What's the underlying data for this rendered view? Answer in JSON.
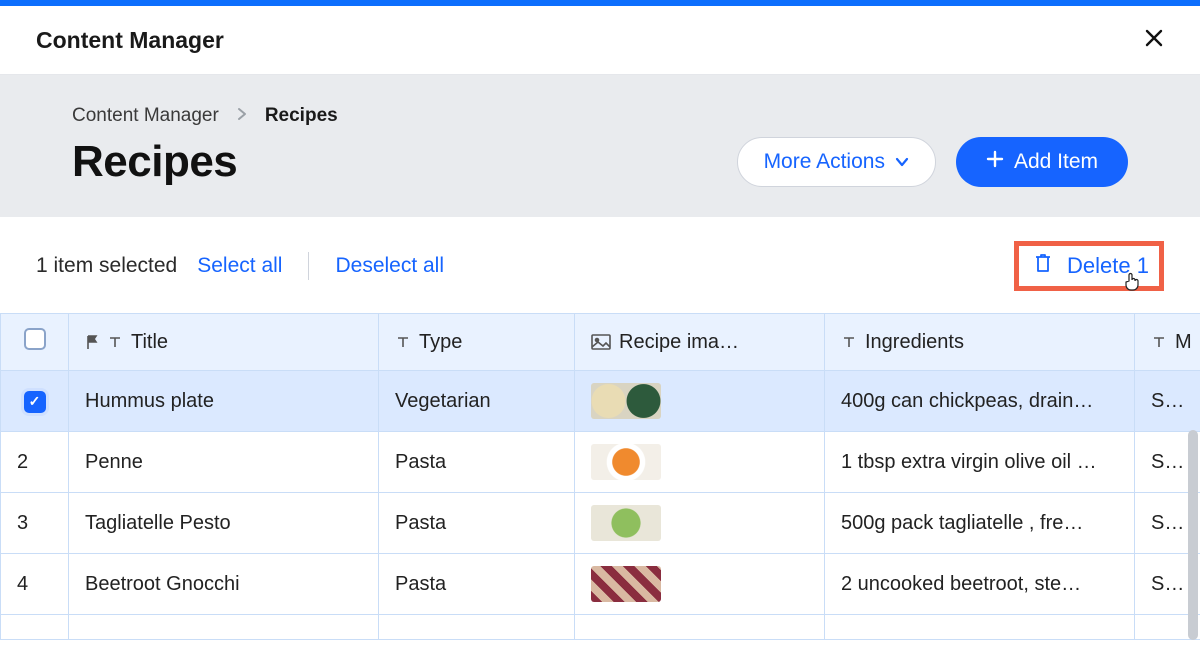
{
  "header": {
    "title": "Content Manager"
  },
  "breadcrumb": {
    "root": "Content Manager",
    "current": "Recipes"
  },
  "page": {
    "title": "Recipes"
  },
  "actions": {
    "more": "More Actions",
    "add": "Add Item"
  },
  "toolbar": {
    "selected_text": "1 item selected",
    "select_all": "Select all",
    "deselect_all": "Deselect all",
    "delete": "Delete 1"
  },
  "columns": {
    "title": "Title",
    "type": "Type",
    "image": "Recipe ima…",
    "ingredients": "Ingredients",
    "method": "M"
  },
  "rows": [
    {
      "num": "",
      "selected": true,
      "title": "Hummus plate",
      "type": "Vegetarian",
      "ingredients": "400g can chickpeas, drain…",
      "method": "STEF"
    },
    {
      "num": "2",
      "selected": false,
      "title": "Penne",
      "type": "Pasta",
      "ingredients": "1 tbsp extra virgin olive oil …",
      "method": "STEF"
    },
    {
      "num": "3",
      "selected": false,
      "title": "Tagliatelle Pesto",
      "type": "Pasta",
      "ingredients": "500g pack tagliatelle , fre…",
      "method": "STEF"
    },
    {
      "num": "4",
      "selected": false,
      "title": "Beetroot Gnocchi",
      "type": "Pasta",
      "ingredients": "2 uncooked beetroot, ste…",
      "method": "STEF"
    }
  ]
}
